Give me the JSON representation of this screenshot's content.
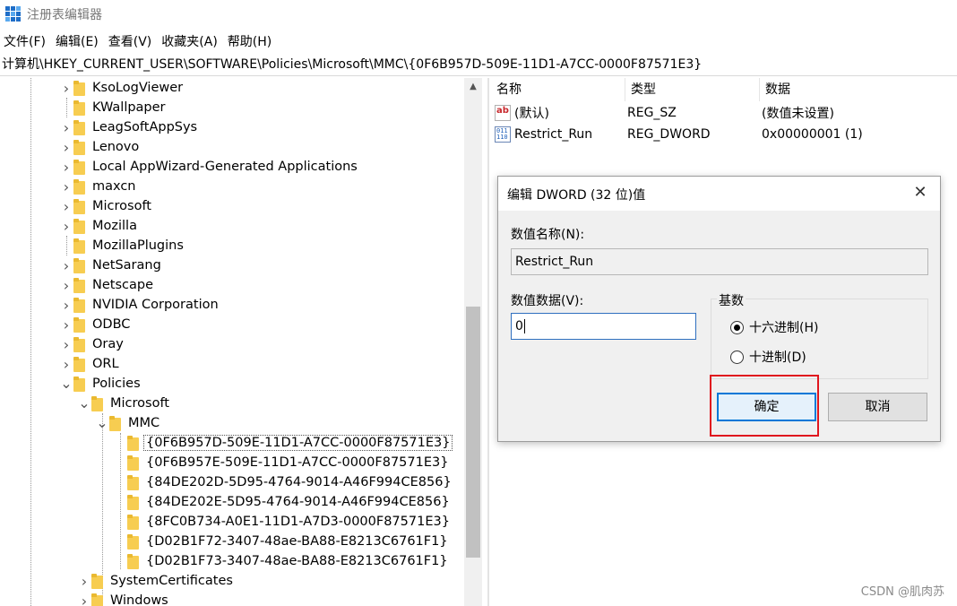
{
  "window": {
    "title": "注册表编辑器"
  },
  "menu": [
    "文件(F)",
    "编辑(E)",
    "查看(V)",
    "收藏夹(A)",
    "帮助(H)"
  ],
  "address": "计算机\\HKEY_CURRENT_USER\\SOFTWARE\\Policies\\Microsoft\\MMC\\{0F6B957D-509E-11D1-A7CC-0000F87571E3}",
  "tree": [
    {
      "label": "KsoLogViewer",
      "expandable": true,
      "expanded": false,
      "depth": 0
    },
    {
      "label": "KWallpaper",
      "expandable": false,
      "expanded": false,
      "depth": 0
    },
    {
      "label": "LeagSoftAppSys",
      "expandable": true,
      "expanded": false,
      "depth": 0
    },
    {
      "label": "Lenovo",
      "expandable": true,
      "expanded": false,
      "depth": 0
    },
    {
      "label": "Local AppWizard-Generated Applications",
      "expandable": true,
      "expanded": false,
      "depth": 0
    },
    {
      "label": "maxcn",
      "expandable": true,
      "expanded": false,
      "depth": 0
    },
    {
      "label": "Microsoft",
      "expandable": true,
      "expanded": false,
      "depth": 0
    },
    {
      "label": "Mozilla",
      "expandable": true,
      "expanded": false,
      "depth": 0
    },
    {
      "label": "MozillaPlugins",
      "expandable": false,
      "expanded": false,
      "depth": 0
    },
    {
      "label": "NetSarang",
      "expandable": true,
      "expanded": false,
      "depth": 0
    },
    {
      "label": "Netscape",
      "expandable": true,
      "expanded": false,
      "depth": 0
    },
    {
      "label": "NVIDIA Corporation",
      "expandable": true,
      "expanded": false,
      "depth": 0
    },
    {
      "label": "ODBC",
      "expandable": true,
      "expanded": false,
      "depth": 0
    },
    {
      "label": "Oray",
      "expandable": true,
      "expanded": false,
      "depth": 0
    },
    {
      "label": "ORL",
      "expandable": true,
      "expanded": false,
      "depth": 0
    },
    {
      "label": "Policies",
      "expandable": true,
      "expanded": true,
      "depth": 0
    },
    {
      "label": "Microsoft",
      "expandable": true,
      "expanded": true,
      "depth": 1
    },
    {
      "label": "MMC",
      "expandable": true,
      "expanded": true,
      "depth": 2
    },
    {
      "label": "{0F6B957D-509E-11D1-A7CC-0000F87571E3}",
      "expandable": false,
      "expanded": false,
      "depth": 3,
      "selected": true
    },
    {
      "label": "{0F6B957E-509E-11D1-A7CC-0000F87571E3}",
      "expandable": false,
      "expanded": false,
      "depth": 3
    },
    {
      "label": "{84DE202D-5D95-4764-9014-A46F994CE856}",
      "expandable": false,
      "expanded": false,
      "depth": 3
    },
    {
      "label": "{84DE202E-5D95-4764-9014-A46F994CE856}",
      "expandable": false,
      "expanded": false,
      "depth": 3
    },
    {
      "label": "{8FC0B734-A0E1-11D1-A7D3-0000F87571E3}",
      "expandable": false,
      "expanded": false,
      "depth": 3
    },
    {
      "label": "{D02B1F72-3407-48ae-BA88-E8213C6761F1}",
      "expandable": false,
      "expanded": false,
      "depth": 3
    },
    {
      "label": "{D02B1F73-3407-48ae-BA88-E8213C6761F1}",
      "expandable": false,
      "expanded": false,
      "depth": 3
    },
    {
      "label": "SystemCertificates",
      "expandable": true,
      "expanded": false,
      "depth": 1
    },
    {
      "label": "Windows",
      "expandable": true,
      "expanded": false,
      "depth": 1
    }
  ],
  "list": {
    "headers": {
      "name": "名称",
      "type": "类型",
      "data": "数据"
    },
    "rows": [
      {
        "icon": "string-value-icon",
        "name": "(默认)",
        "type": "REG_SZ",
        "data": "(数值未设置)"
      },
      {
        "icon": "binary-value-icon",
        "name": "Restrict_Run",
        "type": "REG_DWORD",
        "data": "0x00000001 (1)"
      }
    ]
  },
  "dialog": {
    "title": "编辑 DWORD (32 位)值",
    "name_label": "数值名称(N):",
    "name_value": "Restrict_Run",
    "data_label": "数值数据(V):",
    "data_value": "0",
    "base_label": "基数",
    "hex_label": "十六进制(H)",
    "dec_label": "十进制(D)",
    "selected_base": "hex",
    "ok_label": "确定",
    "cancel_label": "取消"
  },
  "colors": {
    "accent": "#0078d7",
    "highlight": "#e0161e",
    "folder": "#f7cd51"
  },
  "watermark": "CSDN @肌肉苏"
}
